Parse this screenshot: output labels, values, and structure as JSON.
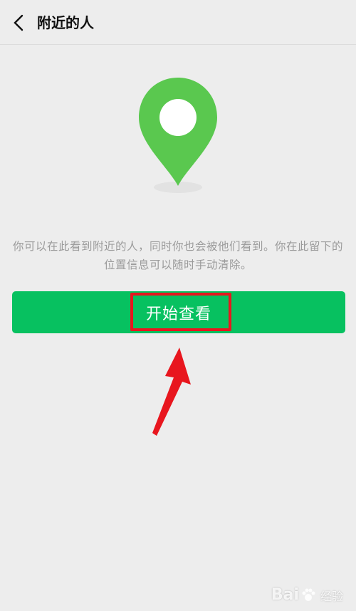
{
  "header": {
    "back_icon": "chevron-left-icon",
    "title": "附近的人"
  },
  "illustration": {
    "icon": "location-pin-icon",
    "pin_color": "#5ac84f"
  },
  "main": {
    "description": "你可以在此看到附近的人，同时你也会被他们看到。你在此留下的位置信息可以随时手动清除。",
    "start_button_label": "开始查看",
    "button_color": "#07c160"
  },
  "annotations": {
    "highlight_color": "#e8161e",
    "arrow_icon": "red-arrow-icon"
  },
  "watermark": {
    "brand": "Bai",
    "sub": "经验",
    "icon": "paw-icon"
  }
}
